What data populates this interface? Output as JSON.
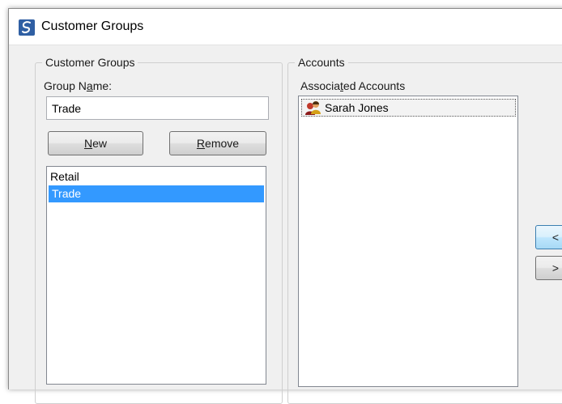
{
  "window": {
    "title": "Customer Groups"
  },
  "customer_groups": {
    "legend": "Customer Groups",
    "group_name_label": {
      "before": "Group N",
      "underlined": "a",
      "after": "me:"
    },
    "group_name_value": "Trade",
    "new_button": {
      "underlined": "N",
      "rest": "ew"
    },
    "remove_button": {
      "underlined": "R",
      "rest": "emove"
    },
    "groups": [
      {
        "label": "Retail",
        "selected": false
      },
      {
        "label": "Trade",
        "selected": true
      }
    ]
  },
  "accounts": {
    "legend": "Accounts",
    "associated_label": {
      "before": "Associa",
      "underlined": "t",
      "after": "ed Accounts"
    },
    "items": [
      {
        "label": "Sarah Jones",
        "icon": "user-group-icon"
      }
    ],
    "move_left_label": "<",
    "move_right_label": ">"
  },
  "colors": {
    "selection": "#3399ff",
    "app_icon": "#2f5fa3"
  }
}
